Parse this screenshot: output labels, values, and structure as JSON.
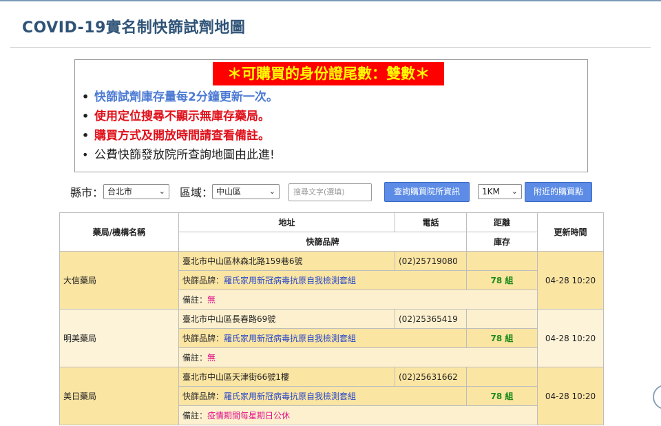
{
  "page": {
    "title": "COVID-19實名制快篩試劑地圖"
  },
  "notice": {
    "banner": "＊可購買的身份證尾數：雙數＊",
    "items": [
      "快篩試劑庫存量每2分鐘更新一次。",
      "使用定位搜尋不顯示無庫存藥局。",
      "購買方式及開放時間請查看備註。",
      "公費快篩發放院所查詢地圖由此進!"
    ]
  },
  "filters": {
    "city_label": "縣市：",
    "city_value": "台北市",
    "district_label": "區域：",
    "district_value": "中山區",
    "search_placeholder": "搜尋文字(選填)",
    "query_button": "查詢購買院所資訊",
    "distance_value": "1KM",
    "nearby_button": "附近的購買點"
  },
  "table": {
    "headers": {
      "name": "藥局/機構名稱",
      "address": "地址",
      "phone": "電話",
      "distance": "距離",
      "updated": "更新時間",
      "brand": "快篩品牌",
      "stock": "庫存"
    },
    "brand_label": "快篩品牌：",
    "note_label": "備註：",
    "rows": [
      {
        "name": "大信藥局",
        "address": "臺北市中山區林森北路159巷6號",
        "phone": "(02)25719080",
        "brand": "羅氏家用新冠病毒抗原自我檢測套組",
        "stock": "78 組",
        "updated": "04-28 10:20",
        "note": "無"
      },
      {
        "name": "明美藥局",
        "address": "臺北市中山區長春路69號",
        "phone": "(02)25365419",
        "brand": "羅氏家用新冠病毒抗原自我檢測套組",
        "stock": "78 組",
        "updated": "04-28 10:20",
        "note": "無"
      },
      {
        "name": "美日藥局",
        "address": "臺北市中山區天津街66號1樓",
        "phone": "(02)25631662",
        "brand": "羅氏家用新冠病毒抗原自我檢測套組",
        "stock": "78 組",
        "updated": "04-28 10:20",
        "note": "疫情期間每星期日公休"
      }
    ]
  },
  "colors": {
    "title": "#2f5377",
    "banner_bg": "#ff0000",
    "banner_text": "#ffff00",
    "button": "#5c8ce6",
    "row_highlight": "#fbe5a3",
    "stock_text": "#1e8b1e",
    "brand_text": "#2a49c9",
    "note_text": "#e0108a"
  }
}
